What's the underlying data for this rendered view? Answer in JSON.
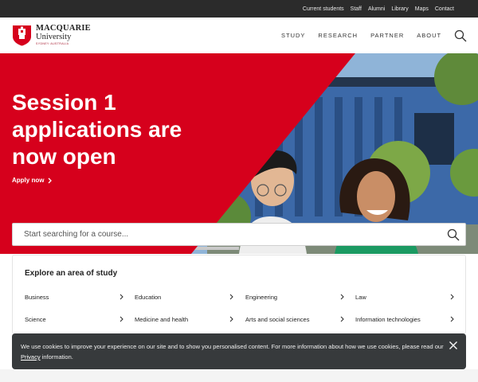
{
  "utility_nav": [
    "Current students",
    "Staff",
    "Alumni",
    "Library",
    "Maps",
    "Contact"
  ],
  "logo": {
    "line1": "MACQUARIE",
    "line2": "University",
    "line3": "SYDNEY·AUSTRALIA"
  },
  "main_nav": [
    "STUDY",
    "RESEARCH",
    "PARTNER",
    "ABOUT"
  ],
  "hero": {
    "title": "Session 1 applications are now open",
    "cta": "Apply now"
  },
  "course_search": {
    "placeholder": "Start searching for a course..."
  },
  "explore": {
    "title": "Explore an area of study",
    "areas": [
      "Business",
      "Education",
      "Engineering",
      "Law",
      "Science",
      "Medicine and health",
      "Arts and social sciences",
      "Information technologies"
    ]
  },
  "cookie": {
    "text_before": "We use cookies to improve your experience on our site and to show you personalised content. For more information about how we use cookies, please read our ",
    "link": "Privacy",
    "text_after": " information."
  },
  "icons": {
    "search": "search-icon",
    "close": "close-icon",
    "chevron": "chevron-right-icon"
  },
  "colors": {
    "brand_red": "#d6001c",
    "utility_bar": "#2b2b2b",
    "cookie_bg": "#373a3c"
  }
}
